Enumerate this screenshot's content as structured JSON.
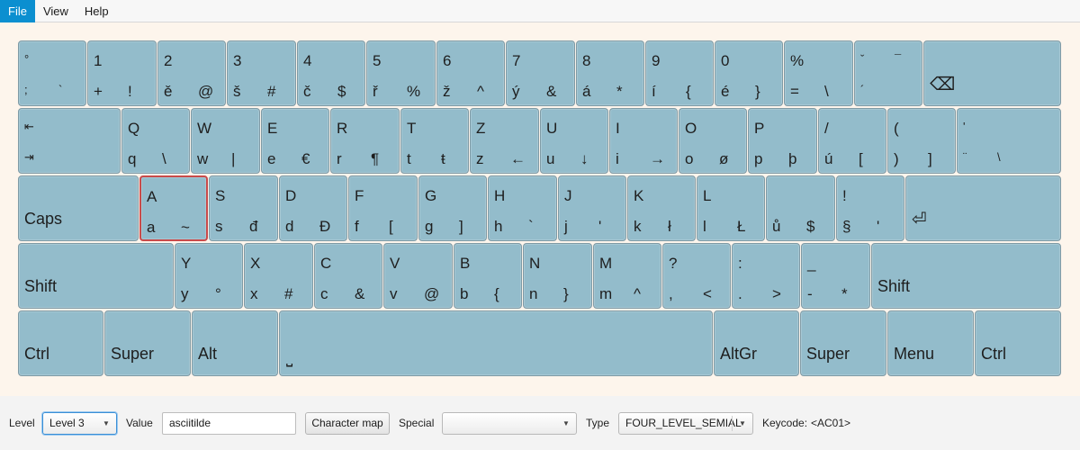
{
  "menu": {
    "file": "File",
    "view": "View",
    "help": "Help"
  },
  "keyboard": {
    "row1": [
      {
        "tl": "°",
        "bl": ";",
        "br": "`"
      },
      {
        "tl": "1",
        "bl": "+",
        "br": "!"
      },
      {
        "tl": "2",
        "bl": "ě",
        "br": "@"
      },
      {
        "tl": "3",
        "bl": "š",
        "br": "#"
      },
      {
        "tl": "4",
        "bl": "č",
        "br": "$"
      },
      {
        "tl": "5",
        "bl": "ř",
        "br": "%"
      },
      {
        "tl": "6",
        "bl": "ž",
        "br": "^"
      },
      {
        "tl": "7",
        "bl": "ý",
        "br": "&"
      },
      {
        "tl": "8",
        "bl": "á",
        "br": "*"
      },
      {
        "tl": "9",
        "bl": "í",
        "br": "{"
      },
      {
        "tl": "0",
        "bl": "é",
        "br": "}"
      },
      {
        "tl": "%",
        "bl": "=",
        "br": "\\"
      },
      {
        "tl": "ˇ",
        "bl": "´",
        "tr": "¯"
      },
      {
        "label": "⌫"
      }
    ],
    "row2": [
      {
        "tl": "⇤",
        "bl": "⇥"
      },
      {
        "tl": "Q",
        "bl": "q",
        "br": "\\"
      },
      {
        "tl": "W",
        "bl": "w",
        "br": "|"
      },
      {
        "tl": "E",
        "bl": "e",
        "br": "€"
      },
      {
        "tl": "R",
        "bl": "r",
        "br": "¶"
      },
      {
        "tl": "T",
        "bl": "t",
        "br": "ŧ"
      },
      {
        "tl": "Z",
        "bl": "z",
        "br": "←"
      },
      {
        "tl": "U",
        "bl": "u",
        "br": "↓"
      },
      {
        "tl": "I",
        "bl": "i",
        "br": "→"
      },
      {
        "tl": "O",
        "bl": "o",
        "br": "ø"
      },
      {
        "tl": "P",
        "bl": "p",
        "br": "þ"
      },
      {
        "tl": "/",
        "bl": "ú",
        "br": "["
      },
      {
        "tl": "(",
        "bl": ")",
        "br": "]"
      },
      {
        "tl": "'",
        "bl": "¨",
        "br": "\\"
      }
    ],
    "row3": [
      {
        "label": "Caps"
      },
      {
        "tl": "A",
        "bl": "a",
        "br": "~"
      },
      {
        "tl": "S",
        "bl": "s",
        "br": "đ"
      },
      {
        "tl": "D",
        "bl": "d",
        "br": "Đ"
      },
      {
        "tl": "F",
        "bl": "f",
        "br": "["
      },
      {
        "tl": "G",
        "bl": "g",
        "br": "]"
      },
      {
        "tl": "H",
        "bl": "h",
        "br": "`"
      },
      {
        "tl": "J",
        "bl": "j",
        "br": "'"
      },
      {
        "tl": "K",
        "bl": "k",
        "br": "ł"
      },
      {
        "tl": "L",
        "bl": "l",
        "br": "Ł"
      },
      {
        "bl": "ů",
        "br": "$"
      },
      {
        "tl": "!",
        "bl": "§",
        "br": "'"
      },
      {
        "label": "⏎"
      }
    ],
    "row4": [
      {
        "label": "Shift"
      },
      {
        "tl": "Y",
        "bl": "y",
        "br": "°"
      },
      {
        "tl": "X",
        "bl": "x",
        "br": "#"
      },
      {
        "tl": "C",
        "bl": "c",
        "br": "&"
      },
      {
        "tl": "V",
        "bl": "v",
        "br": "@"
      },
      {
        "tl": "B",
        "bl": "b",
        "br": "{"
      },
      {
        "tl": "N",
        "bl": "n",
        "br": "}"
      },
      {
        "tl": "M",
        "bl": "m",
        "br": "^"
      },
      {
        "tl": "?",
        "bl": ",",
        "br": "<"
      },
      {
        "tl": ":",
        "bl": ".",
        "br": ">"
      },
      {
        "tl": "_",
        "bl": "-",
        "br": "*"
      },
      {
        "label": "Shift"
      }
    ],
    "row5": [
      {
        "label": "Ctrl"
      },
      {
        "label": "Super"
      },
      {
        "label": "Alt"
      },
      {
        "label": "⎵"
      },
      {
        "label": "AltGr"
      },
      {
        "label": "Super"
      },
      {
        "label": "Menu"
      },
      {
        "label": "Ctrl"
      }
    ]
  },
  "toolbar": {
    "level_label": "Level",
    "level_value": "Level 3",
    "value_label": "Value",
    "value_text": "asciitilde",
    "charmap_button": "Character map",
    "special_label": "Special",
    "special_value": "",
    "type_label": "Type",
    "type_value": "FOUR_LEVEL_SEMIAL",
    "keycode_label": "Keycode:",
    "keycode_value": "<AC01>"
  },
  "colors": {
    "key": "#93bccb",
    "keyboard_bg": "#fdf5ec",
    "selected_border": "#c94a4a",
    "menu_active": "#0b8fd0"
  }
}
